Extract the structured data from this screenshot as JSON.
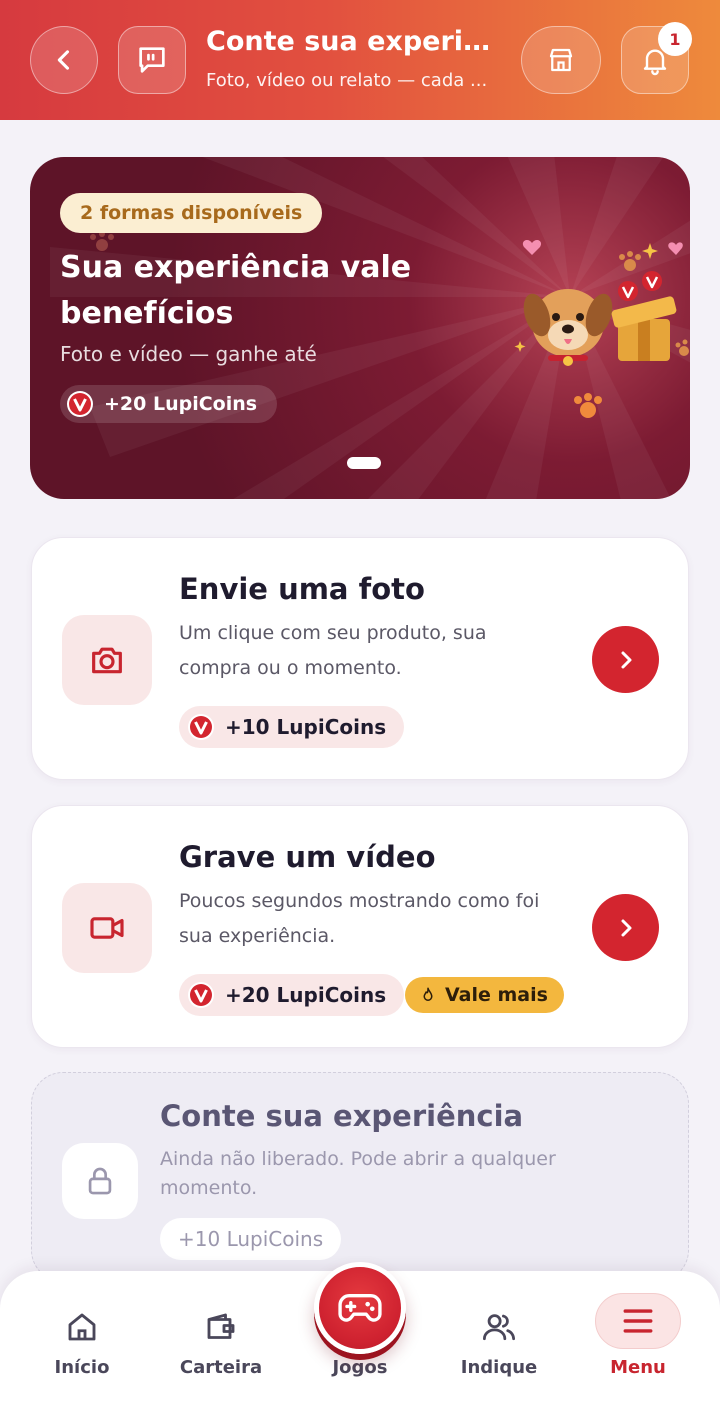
{
  "header": {
    "title": "Conte sua experiê...",
    "subtitle": "Foto, vídeo ou relato — cada ...",
    "notification_count": "1",
    "icons": [
      "back-icon",
      "chat-icon",
      "store-icon",
      "bell-icon"
    ],
    "colors": {
      "gradient_start": "#d63a3f",
      "gradient_end": "#ee8a3c"
    }
  },
  "banner": {
    "pill": "2 formas disponíveis",
    "title": "Sua experiência vale benefícios",
    "subtitle": "Foto e vídeo — ganhe até",
    "coins": "+20 LupiCoins",
    "carousel": {
      "current": 1,
      "total": 1
    }
  },
  "cards": [
    {
      "title": "Envie uma foto",
      "description": "Um clique com seu produto, sua compra ou o momento.",
      "coins": "+10 LupiCoins",
      "icon": "camera-icon"
    },
    {
      "title": "Grave um vídeo",
      "description": "Poucos segundos mostrando como foi sua experiência.",
      "coins": "+20 LupiCoins",
      "badge": "Vale mais",
      "icon": "video-icon"
    },
    {
      "title": "Conte sua experiência",
      "description": "Ainda não liberado. Pode abrir a qualquer momento.",
      "coins": "+10 LupiCoins",
      "icon": "lock-icon",
      "locked": true
    }
  ],
  "nav": {
    "items": [
      {
        "label": "Início",
        "icon": "home-icon"
      },
      {
        "label": "Carteira",
        "icon": "wallet-icon"
      },
      {
        "label": "Jogos",
        "icon": "gamepad-icon"
      },
      {
        "label": "Indique",
        "icon": "users-icon"
      },
      {
        "label": "Menu",
        "icon": "menu-icon",
        "active": true
      }
    ]
  },
  "colors": {
    "accent": "#d3252f",
    "coin_bg": "#f9e7e7",
    "badge": "#f3b73e"
  }
}
